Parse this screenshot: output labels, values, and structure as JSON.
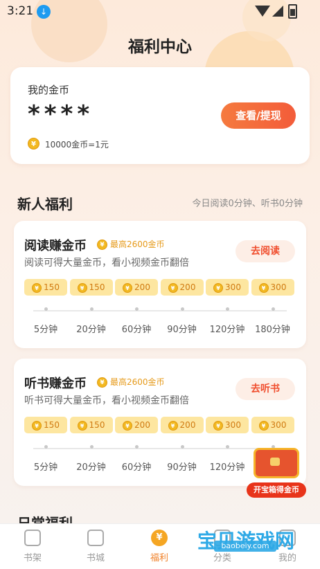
{
  "status_bar": {
    "time": "3:21"
  },
  "page": {
    "title": "福利中心"
  },
  "wallet": {
    "label": "我的金币",
    "amount": "****",
    "rate": "10000金币=1元",
    "button": "查看/提现"
  },
  "newcomer": {
    "title": "新人福利",
    "note": "今日阅读0分钟、听书0分钟"
  },
  "read_card": {
    "title": "阅读赚金币",
    "max_reward": "最高2600金币",
    "description": "阅读可得大量金币，看小视频金币翻倍",
    "button": "去阅读",
    "rewards": [
      "150",
      "150",
      "200",
      "200",
      "300",
      "300"
    ],
    "durations": [
      "5分钟",
      "20分钟",
      "60分钟",
      "90分钟",
      "120分钟",
      "180分钟"
    ]
  },
  "listen_card": {
    "title": "听书赚金币",
    "max_reward": "最高2600金币",
    "description": "听书可得大量金币，看小视频金币翻倍",
    "button": "去听书",
    "rewards": [
      "150",
      "150",
      "200",
      "200",
      "300",
      "300"
    ],
    "durations": [
      "5分钟",
      "20分钟",
      "60分钟",
      "90分钟",
      "120分钟"
    ]
  },
  "daily": {
    "title": "日常福利"
  },
  "chest": {
    "label": "开宝箱得金币"
  },
  "coin_symbol": "¥",
  "tabs": [
    {
      "label": "书架",
      "icon": "bookshelf-icon"
    },
    {
      "label": "书城",
      "icon": "bookstore-icon"
    },
    {
      "label": "福利",
      "icon": "welfare-coin-icon"
    },
    {
      "label": "分类",
      "icon": "category-icon"
    },
    {
      "label": "我的",
      "icon": "profile-icon"
    }
  ],
  "watermark": {
    "text": "宝贝游戏网",
    "url": "baobeiy.com"
  }
}
